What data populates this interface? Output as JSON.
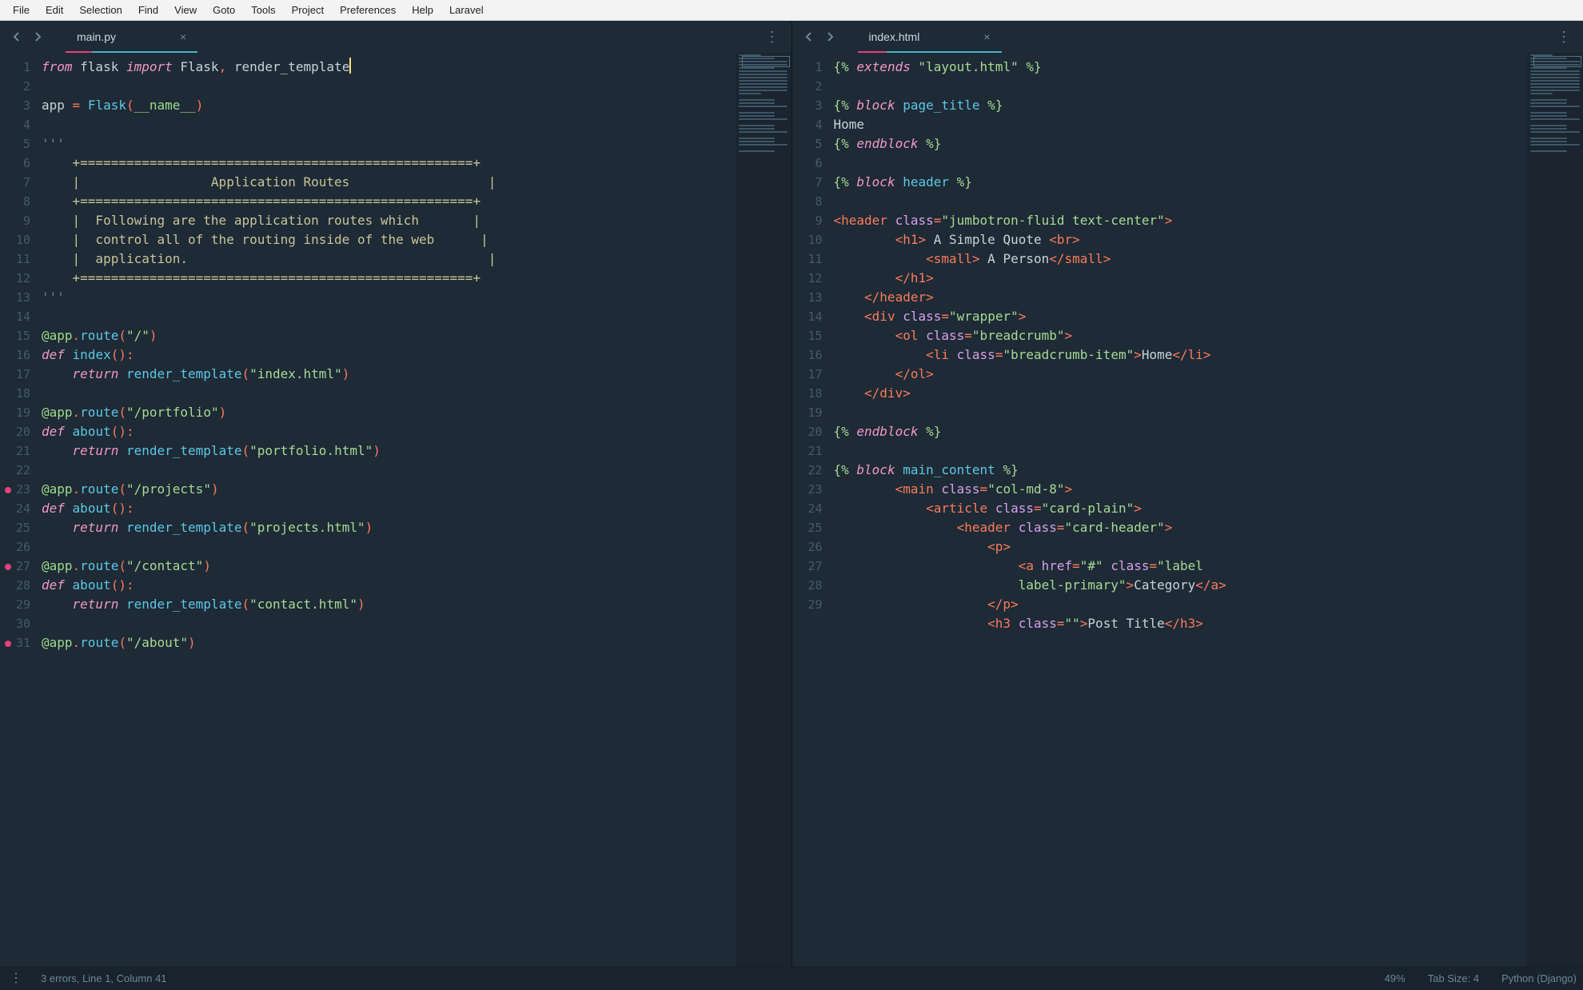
{
  "menubar": [
    "File",
    "Edit",
    "Selection",
    "Find",
    "View",
    "Goto",
    "Tools",
    "Project",
    "Preferences",
    "Help",
    "Laravel"
  ],
  "leftPane": {
    "tab": {
      "title": "main.py"
    },
    "gutter": {
      "start": 1,
      "end": 31,
      "marks": [
        23,
        27,
        31
      ]
    },
    "code": [
      [
        {
          "c": "kw",
          "t": "from"
        },
        {
          "t": " flask "
        },
        {
          "c": "kw",
          "t": "import"
        },
        {
          "t": " Flask"
        },
        {
          "c": "op",
          "t": ","
        },
        {
          "t": " render_template"
        },
        {
          "cursor": true
        }
      ],
      [],
      [
        {
          "t": "app "
        },
        {
          "c": "op",
          "t": "="
        },
        {
          "t": " "
        },
        {
          "c": "fn",
          "t": "Flask"
        },
        {
          "c": "op",
          "t": "("
        },
        {
          "c": "name",
          "t": "__name__"
        },
        {
          "c": "op",
          "t": ")"
        }
      ],
      [],
      [
        {
          "c": "cmt",
          "t": "'''"
        }
      ],
      [
        {
          "c": "box",
          "t": "    +===================================================+"
        }
      ],
      [
        {
          "c": "box",
          "t": "    |                 Application Routes                  |"
        }
      ],
      [
        {
          "c": "box",
          "t": "    +===================================================+"
        }
      ],
      [
        {
          "c": "box",
          "t": "    |  Following are the application routes which       |"
        }
      ],
      [
        {
          "c": "box",
          "t": "    |  control all of the routing inside of the web      |"
        }
      ],
      [
        {
          "c": "box",
          "t": "    |  application.                                       |"
        }
      ],
      [
        {
          "c": "box",
          "t": "    +===================================================+"
        }
      ],
      [
        {
          "c": "cmt",
          "t": "'''"
        }
      ],
      [],
      [
        {
          "c": "name",
          "t": "@app"
        },
        {
          "c": "op",
          "t": "."
        },
        {
          "c": "fn",
          "t": "route"
        },
        {
          "c": "op",
          "t": "("
        },
        {
          "c": "str",
          "t": "\"/\""
        },
        {
          "c": "op",
          "t": ")"
        }
      ],
      [
        {
          "c": "kw",
          "t": "def"
        },
        {
          "t": " "
        },
        {
          "c": "fn",
          "t": "index"
        },
        {
          "c": "op",
          "t": "()"
        },
        {
          "c": "op",
          "t": ":"
        }
      ],
      [
        {
          "t": "    "
        },
        {
          "c": "kw",
          "t": "return"
        },
        {
          "t": " "
        },
        {
          "c": "fn",
          "t": "render_template"
        },
        {
          "c": "op",
          "t": "("
        },
        {
          "c": "str",
          "t": "\"index.html\""
        },
        {
          "c": "op",
          "t": ")"
        }
      ],
      [],
      [
        {
          "c": "name",
          "t": "@app"
        },
        {
          "c": "op",
          "t": "."
        },
        {
          "c": "fn",
          "t": "route"
        },
        {
          "c": "op",
          "t": "("
        },
        {
          "c": "str",
          "t": "\"/portfolio\""
        },
        {
          "c": "op",
          "t": ")"
        }
      ],
      [
        {
          "c": "kw",
          "t": "def"
        },
        {
          "t": " "
        },
        {
          "c": "fn",
          "t": "about"
        },
        {
          "c": "op",
          "t": "()"
        },
        {
          "c": "op",
          "t": ":"
        }
      ],
      [
        {
          "t": "    "
        },
        {
          "c": "kw",
          "t": "return"
        },
        {
          "t": " "
        },
        {
          "c": "fn",
          "t": "render_template"
        },
        {
          "c": "op",
          "t": "("
        },
        {
          "c": "str",
          "t": "\"portfolio.html\""
        },
        {
          "c": "op",
          "t": ")"
        }
      ],
      [],
      [
        {
          "c": "name",
          "t": "@app"
        },
        {
          "c": "op",
          "t": "."
        },
        {
          "c": "fn",
          "t": "route"
        },
        {
          "c": "op",
          "t": "("
        },
        {
          "c": "str",
          "t": "\"/projects\""
        },
        {
          "c": "op",
          "t": ")"
        }
      ],
      [
        {
          "c": "kw",
          "t": "def"
        },
        {
          "t": " "
        },
        {
          "c": "fn",
          "t": "about"
        },
        {
          "c": "op",
          "t": "()"
        },
        {
          "c": "op",
          "t": ":"
        }
      ],
      [
        {
          "t": "    "
        },
        {
          "c": "kw",
          "t": "return"
        },
        {
          "t": " "
        },
        {
          "c": "fn",
          "t": "render_template"
        },
        {
          "c": "op",
          "t": "("
        },
        {
          "c": "str",
          "t": "\"projects.html\""
        },
        {
          "c": "op",
          "t": ")"
        }
      ],
      [],
      [
        {
          "c": "name",
          "t": "@app"
        },
        {
          "c": "op",
          "t": "."
        },
        {
          "c": "fn",
          "t": "route"
        },
        {
          "c": "op",
          "t": "("
        },
        {
          "c": "str",
          "t": "\"/contact\""
        },
        {
          "c": "op",
          "t": ")"
        }
      ],
      [
        {
          "c": "kw",
          "t": "def"
        },
        {
          "t": " "
        },
        {
          "c": "fn",
          "t": "about"
        },
        {
          "c": "op",
          "t": "()"
        },
        {
          "c": "op",
          "t": ":"
        }
      ],
      [
        {
          "t": "    "
        },
        {
          "c": "kw",
          "t": "return"
        },
        {
          "t": " "
        },
        {
          "c": "fn",
          "t": "render_template"
        },
        {
          "c": "op",
          "t": "("
        },
        {
          "c": "str",
          "t": "\"contact.html\""
        },
        {
          "c": "op",
          "t": ")"
        }
      ],
      [],
      [
        {
          "c": "name",
          "t": "@app"
        },
        {
          "c": "op",
          "t": "."
        },
        {
          "c": "fn",
          "t": "route"
        },
        {
          "c": "op",
          "t": "("
        },
        {
          "c": "str",
          "t": "\"/about\""
        },
        {
          "c": "op",
          "t": ")"
        }
      ]
    ]
  },
  "rightPane": {
    "tab": {
      "title": "index.html"
    },
    "gutter": {
      "start": 1,
      "end": 29,
      "marks": []
    },
    "code": [
      [
        {
          "c": "tj",
          "t": "{% "
        },
        {
          "c": "tjkw",
          "t": "extends"
        },
        {
          "t": " "
        },
        {
          "c": "str",
          "t": "\"layout.html\""
        },
        {
          "c": "tj",
          "t": " %}"
        }
      ],
      [],
      [
        {
          "c": "tj",
          "t": "{% "
        },
        {
          "c": "tjkw",
          "t": "block"
        },
        {
          "t": " "
        },
        {
          "c": "fn",
          "t": "page_title"
        },
        {
          "c": "tj",
          "t": " %}"
        }
      ],
      [
        {
          "t": "Home"
        }
      ],
      [
        {
          "c": "tj",
          "t": "{% "
        },
        {
          "c": "tjkw",
          "t": "endblock"
        },
        {
          "c": "tj",
          "t": " %}"
        }
      ],
      [],
      [
        {
          "c": "tj",
          "t": "{% "
        },
        {
          "c": "tjkw",
          "t": "block"
        },
        {
          "t": " "
        },
        {
          "c": "fn",
          "t": "header"
        },
        {
          "c": "tj",
          "t": " %}"
        }
      ],
      [],
      [
        {
          "c": "op",
          "t": "<"
        },
        {
          "c": "tag",
          "t": "header"
        },
        {
          "t": " "
        },
        {
          "c": "attr",
          "t": "class"
        },
        {
          "c": "op",
          "t": "="
        },
        {
          "c": "str",
          "t": "\"jumbotron-fluid text-center\""
        },
        {
          "c": "op",
          "t": ">"
        }
      ],
      [
        {
          "t": "        "
        },
        {
          "c": "op",
          "t": "<"
        },
        {
          "c": "tag",
          "t": "h1"
        },
        {
          "c": "op",
          "t": ">"
        },
        {
          "t": " A Simple Quote "
        },
        {
          "c": "op",
          "t": "<"
        },
        {
          "c": "tag",
          "t": "br"
        },
        {
          "c": "op",
          "t": ">"
        }
      ],
      [
        {
          "t": "            "
        },
        {
          "c": "op",
          "t": "<"
        },
        {
          "c": "tag",
          "t": "small"
        },
        {
          "c": "op",
          "t": ">"
        },
        {
          "t": " A Person"
        },
        {
          "c": "op",
          "t": "</"
        },
        {
          "c": "tag",
          "t": "small"
        },
        {
          "c": "op",
          "t": ">"
        }
      ],
      [
        {
          "t": "        "
        },
        {
          "c": "op",
          "t": "</"
        },
        {
          "c": "tag",
          "t": "h1"
        },
        {
          "c": "op",
          "t": ">"
        }
      ],
      [
        {
          "t": "    "
        },
        {
          "c": "op",
          "t": "</"
        },
        {
          "c": "tag",
          "t": "header"
        },
        {
          "c": "op",
          "t": ">"
        }
      ],
      [
        {
          "t": "    "
        },
        {
          "c": "op",
          "t": "<"
        },
        {
          "c": "tag",
          "t": "div"
        },
        {
          "t": " "
        },
        {
          "c": "attr",
          "t": "class"
        },
        {
          "c": "op",
          "t": "="
        },
        {
          "c": "str",
          "t": "\"wrapper\""
        },
        {
          "c": "op",
          "t": ">"
        }
      ],
      [
        {
          "t": "        "
        },
        {
          "c": "op",
          "t": "<"
        },
        {
          "c": "tag",
          "t": "ol"
        },
        {
          "t": " "
        },
        {
          "c": "attr",
          "t": "class"
        },
        {
          "c": "op",
          "t": "="
        },
        {
          "c": "str",
          "t": "\"breadcrumb\""
        },
        {
          "c": "op",
          "t": ">"
        }
      ],
      [
        {
          "t": "            "
        },
        {
          "c": "op",
          "t": "<"
        },
        {
          "c": "tag",
          "t": "li"
        },
        {
          "t": " "
        },
        {
          "c": "attr",
          "t": "class"
        },
        {
          "c": "op",
          "t": "="
        },
        {
          "c": "str",
          "t": "\"breadcrumb-item\""
        },
        {
          "c": "op",
          "t": ">"
        },
        {
          "t": "Home"
        },
        {
          "c": "op",
          "t": "</"
        },
        {
          "c": "tag",
          "t": "li"
        },
        {
          "c": "op",
          "t": ">"
        }
      ],
      [
        {
          "t": "        "
        },
        {
          "c": "op",
          "t": "</"
        },
        {
          "c": "tag",
          "t": "ol"
        },
        {
          "c": "op",
          "t": ">"
        }
      ],
      [
        {
          "t": "    "
        },
        {
          "c": "op",
          "t": "</"
        },
        {
          "c": "tag",
          "t": "div"
        },
        {
          "c": "op",
          "t": ">"
        }
      ],
      [],
      [
        {
          "c": "tj",
          "t": "{% "
        },
        {
          "c": "tjkw",
          "t": "endblock"
        },
        {
          "c": "tj",
          "t": " %}"
        }
      ],
      [],
      [
        {
          "c": "tj",
          "t": "{% "
        },
        {
          "c": "tjkw",
          "t": "block"
        },
        {
          "t": " "
        },
        {
          "c": "fn",
          "t": "main_content"
        },
        {
          "c": "tj",
          "t": " %}"
        }
      ],
      [
        {
          "t": "        "
        },
        {
          "c": "op",
          "t": "<"
        },
        {
          "c": "tag",
          "t": "main"
        },
        {
          "t": " "
        },
        {
          "c": "attr",
          "t": "class"
        },
        {
          "c": "op",
          "t": "="
        },
        {
          "c": "str",
          "t": "\"col-md-8\""
        },
        {
          "c": "op",
          "t": ">"
        }
      ],
      [
        {
          "t": "            "
        },
        {
          "c": "op",
          "t": "<"
        },
        {
          "c": "tag",
          "t": "article"
        },
        {
          "t": " "
        },
        {
          "c": "attr",
          "t": "class"
        },
        {
          "c": "op",
          "t": "="
        },
        {
          "c": "str",
          "t": "\"card-plain\""
        },
        {
          "c": "op",
          "t": ">"
        }
      ],
      [
        {
          "t": "                "
        },
        {
          "c": "op",
          "t": "<"
        },
        {
          "c": "tag",
          "t": "header"
        },
        {
          "t": " "
        },
        {
          "c": "attr",
          "t": "class"
        },
        {
          "c": "op",
          "t": "="
        },
        {
          "c": "str",
          "t": "\"card-header\""
        },
        {
          "c": "op",
          "t": ">"
        }
      ],
      [
        {
          "t": "                    "
        },
        {
          "c": "op",
          "t": "<"
        },
        {
          "c": "tag",
          "t": "p"
        },
        {
          "c": "op",
          "t": ">"
        }
      ],
      [
        {
          "t": "                        "
        },
        {
          "c": "op",
          "t": "<"
        },
        {
          "c": "tag",
          "t": "a"
        },
        {
          "t": " "
        },
        {
          "c": "attr",
          "t": "href"
        },
        {
          "c": "op",
          "t": "="
        },
        {
          "c": "str",
          "t": "\"#\""
        },
        {
          "t": " "
        },
        {
          "c": "attr",
          "t": "class"
        },
        {
          "c": "op",
          "t": "="
        },
        {
          "c": "str",
          "t": "\"label "
        }
      ],
      [
        {
          "t": "                        "
        },
        {
          "c": "str",
          "t": "label-primary\""
        },
        {
          "c": "op",
          "t": ">"
        },
        {
          "t": "Category"
        },
        {
          "c": "op",
          "t": "</"
        },
        {
          "c": "tag",
          "t": "a"
        },
        {
          "c": "op",
          "t": ">"
        }
      ],
      [
        {
          "t": "                    "
        },
        {
          "c": "op",
          "t": "</"
        },
        {
          "c": "tag",
          "t": "p"
        },
        {
          "c": "op",
          "t": ">"
        }
      ],
      [
        {
          "t": "                    "
        },
        {
          "c": "op",
          "t": "<"
        },
        {
          "c": "tag",
          "t": "h3"
        },
        {
          "t": " "
        },
        {
          "c": "attr",
          "t": "class"
        },
        {
          "c": "op",
          "t": "="
        },
        {
          "c": "str",
          "t": "\"\""
        },
        {
          "c": "op",
          "t": ">"
        },
        {
          "t": "Post Title"
        },
        {
          "c": "op",
          "t": "</"
        },
        {
          "c": "tag",
          "t": "h3"
        },
        {
          "c": "op",
          "t": ">"
        }
      ]
    ]
  },
  "statusbar": {
    "errors": "3 errors, Line 1, Column 41",
    "zoom": "49%",
    "tabsize": "Tab Size: 4",
    "syntax": "Python (Django)"
  }
}
